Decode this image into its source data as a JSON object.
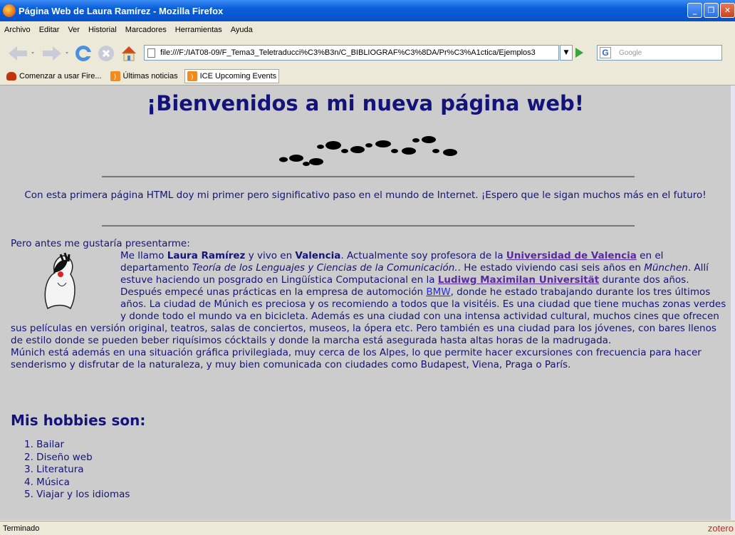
{
  "window": {
    "title": "Página Web de Laura Ramírez - Mozilla Firefox"
  },
  "menu": [
    "Archivo",
    "Editar",
    "Ver",
    "Historial",
    "Marcadores",
    "Herramientas",
    "Ayuda"
  ],
  "nav": {
    "url": "file:///F:/IAT08-09/F_Tema3_Teletraducci%C3%B3n/C_BIBLIOGRAF%C3%8DA/Pr%C3%A1ctica/Ejemplos3",
    "search_placeholder": "Google"
  },
  "bookmarks": [
    "Comenzar a usar Fire...",
    "Últimas noticias",
    "ICE Upcoming Events"
  ],
  "page": {
    "heading": "¡Bienvenidos a mi nueva página web!",
    "intro": "Con esta primera página HTML doy mi primer pero significativo paso en el mundo de Internet. ¡Espero que le sigan muchos más en el futuro!",
    "present": "Pero antes me gustaría presentarme:",
    "bio": {
      "t1": "Me llamo ",
      "name": "Laura Ramírez",
      "t2": " y vivo en ",
      "city": "Valencia",
      "t3": ". Actualmente soy profesora de la ",
      "link_uv": "Universidad de Valencia",
      "t4": " en el departamento ",
      "dept": "Teoría de los Lenguajes y Ciencias de la Comunicación.",
      "t5": ". He estado viviendo casi seis años en ",
      "munchen": "München",
      "t6": ". Allí estuve haciendo un posgrado en Lingüística Computacional en la ",
      "link_lmu": "Ludiwg Maximilan Universität",
      "t7": " durante dos años. Después empecé unas prácticas en la empresa de automoción ",
      "link_bmw": "BMW",
      "t8": ", donde he estado trabajando durante los tres últimos años. La ciudad de Múnich es preciosa y os recomiendo a todos que la visitéis. Es una ciudad que tiene muchas zonas verdes y donde todo el mundo va en bicicleta. Además es una ciudad con una intensa actividad cultural, muchos cines que ofrecen sus películas en versión original, teatros, salas de conciertos, museos, la ópera etc. Pero también es una ciudad para los jóvenes, con bares llenos de estilo donde se pueden beber riquísimos cócktails y donde la marcha está asegurada hasta altas horas de la madrugada.",
      "p2": "Múnich está además en una situación gráfica privilegiada, muy cerca de los Alpes, lo que permite hacer excursiones con frecuencia para hacer senderismo y disfrutar de la naturaleza, y muy bien comunicada con ciudades como Budapest, Viena, Praga o París."
    },
    "hobbies_title": "Mis hobbies son:",
    "hobbies": [
      "1. Bailar",
      "2. Diseño web",
      "3. Literatura",
      "4. Música",
      "5. Viajar y los idiomas"
    ]
  },
  "status": {
    "text": "Terminado",
    "zotero": "zotero"
  }
}
